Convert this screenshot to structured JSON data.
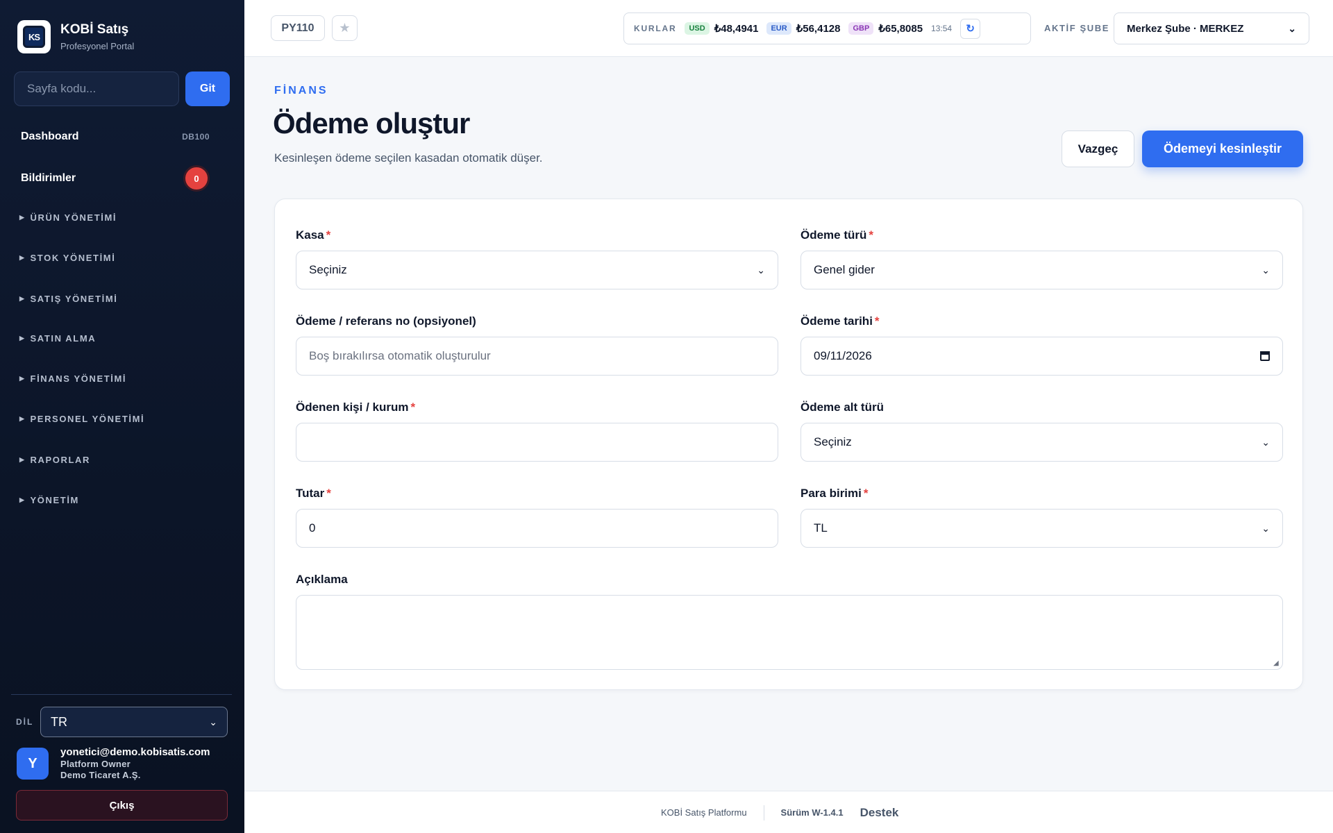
{
  "brand": {
    "title": "KOBİ Satış",
    "subtitle": "Profesyonel Portal",
    "logo_text": "KS"
  },
  "sidebar": {
    "search_placeholder": "Sayfa kodu...",
    "go_label": "Git",
    "items": [
      {
        "label": "Dashboard",
        "code": "DB100"
      },
      {
        "label": "Bildirimler",
        "badge": "0"
      }
    ],
    "groups": [
      "ÜRÜN YÖNETİMİ",
      "STOK YÖNETİMİ",
      "SATIŞ YÖNETİMİ",
      "SATIN ALMA",
      "FİNANS YÖNETİMİ",
      "PERSONEL YÖNETİMİ",
      "RAPORLAR",
      "YÖNETİM"
    ],
    "language_label": "DİL",
    "language_value": "TR",
    "user": {
      "initial": "Y",
      "email": "yonetici@demo.kobisatis.com",
      "role": "Platform Owner",
      "company": "Demo Ticaret A.Ş."
    },
    "logout_label": "Çıkış"
  },
  "topbar": {
    "page_code": "PY110",
    "rates_label": "KURLAR",
    "rates": [
      {
        "code": "USD",
        "value": "₺48,4941",
        "color": "#17803d"
      },
      {
        "code": "EUR",
        "value": "₺56,4128",
        "color": "#2a5bc7"
      },
      {
        "code": "GBP",
        "value": "₺65,8085",
        "color": "#8a36b5"
      }
    ],
    "rates_time": "13:54",
    "branch_label": "AKTİF ŞUBE",
    "branch_value": "Merkez Şube · MERKEZ"
  },
  "page": {
    "section": "FİNANS",
    "title": "Ödeme oluştur",
    "subtitle": "Kesinleşen ödeme seçilen kasadan otomatik düşer.",
    "cancel_label": "Vazgeç",
    "confirm_label": "Ödemeyi kesinleştir",
    "accent_color": "#2f6df0"
  },
  "form": {
    "kasa": {
      "label": "Kasa",
      "value": "Seçiniz"
    },
    "odeme_turu": {
      "label": "Ödeme türü",
      "value": "Genel gider"
    },
    "referans": {
      "label": "Ödeme / referans no (opsiyonel)",
      "placeholder": "Boş bırakılırsa otomatik oluşturulur"
    },
    "tarih": {
      "label": "Ödeme tarihi",
      "value": "09/11/2026"
    },
    "odenen": {
      "label": "Ödenen kişi / kurum",
      "value": ""
    },
    "alt_tur": {
      "label": "Ödeme alt türü",
      "value": "Seçiniz"
    },
    "tutar": {
      "label": "Tutar",
      "value": "0"
    },
    "para_birimi": {
      "label": "Para birimi",
      "value": "TL"
    },
    "aciklama": {
      "label": "Açıklama",
      "value": ""
    }
  },
  "footer": {
    "platform": "KOBİ Satış Platformu",
    "version": "Sürüm W-1.4.1",
    "support": "Destek"
  }
}
